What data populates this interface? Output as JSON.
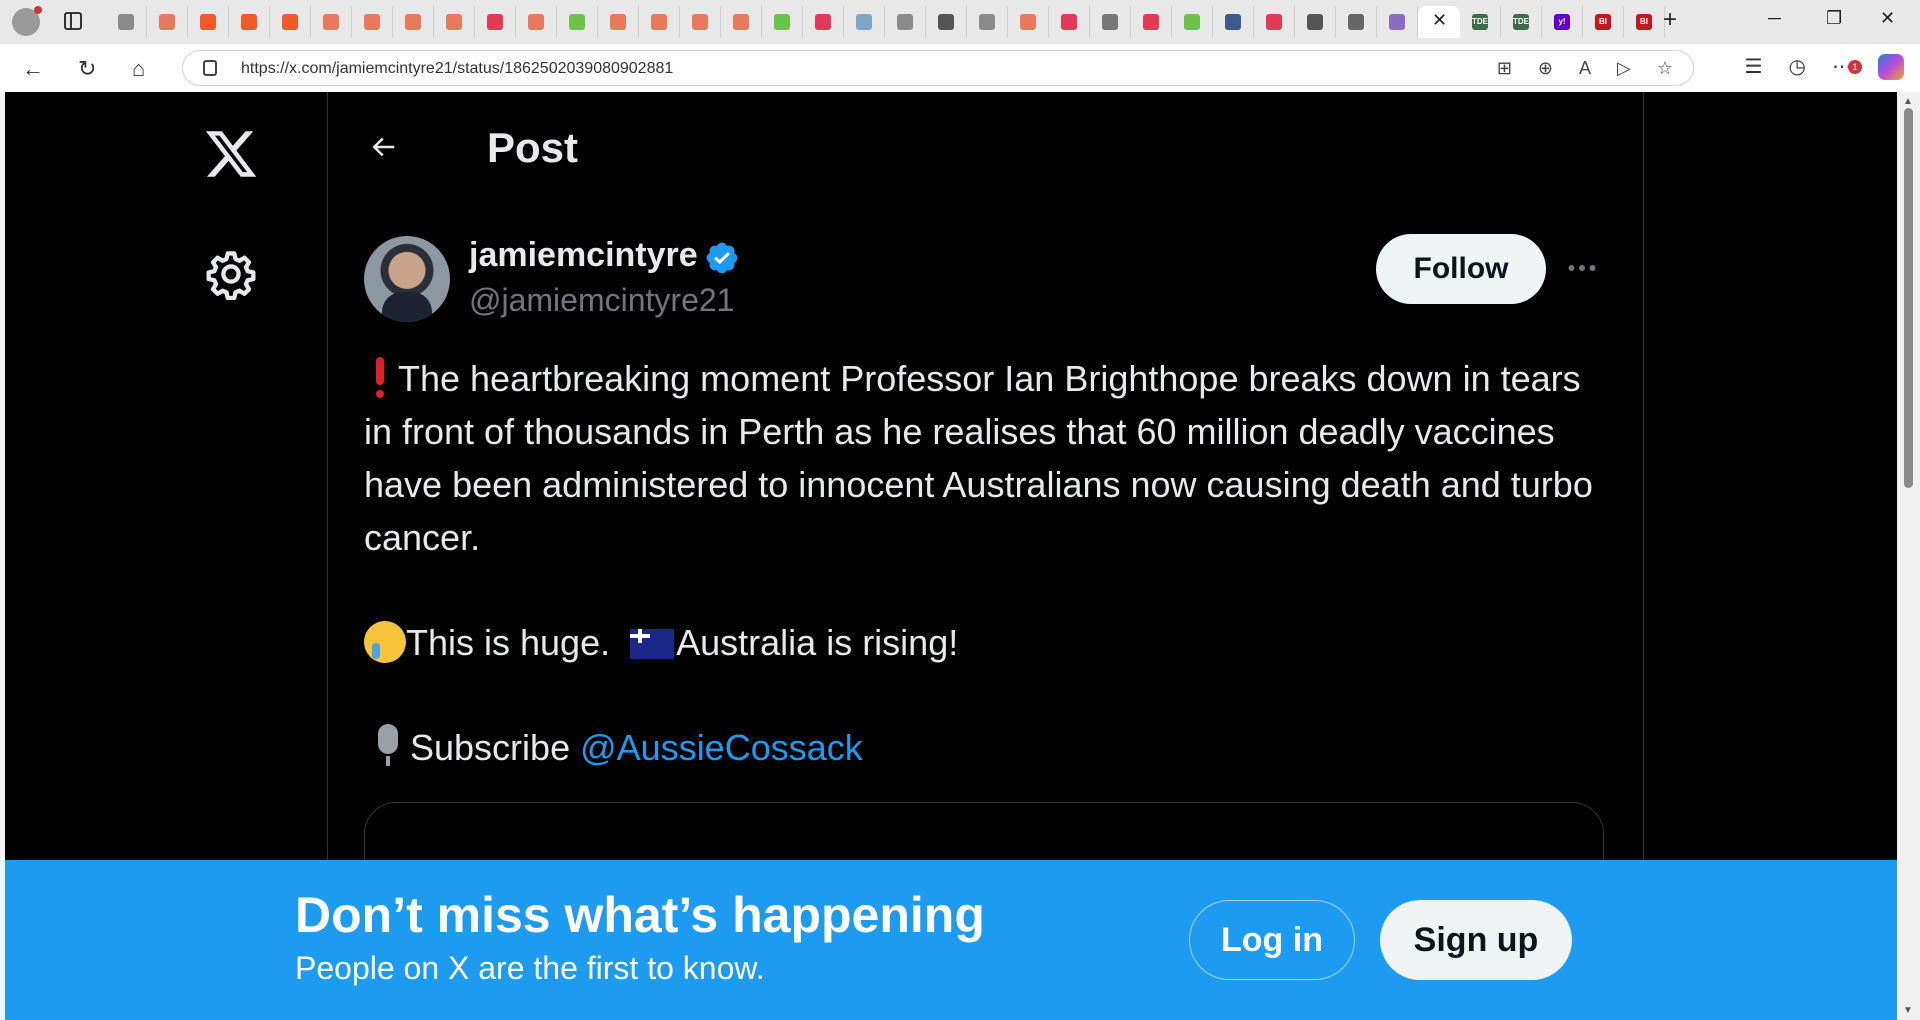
{
  "browser": {
    "url": "https://x.com/jamiemcintyre21/status/1862502039080902881",
    "tab_favicon_colors": [
      "#8a8a8a",
      "#e8795a",
      "#f05a28",
      "#f05a28",
      "#f05a28",
      "#e8795a",
      "#e8795a",
      "#e8795a",
      "#e8795a",
      "#e23a56",
      "#e8795a",
      "#6cc24a",
      "#e8795a",
      "#e8795a",
      "#e8795a",
      "#e8795a",
      "#6cc24a",
      "#e23a56",
      "#7aa7c7",
      "#8a8a8a",
      "#555555",
      "#8a8a8a",
      "#e8795a",
      "#e23a56",
      "#777777",
      "#e23a56",
      "#6cc24a",
      "#3d5a8a",
      "#e23a56",
      "#555555",
      "#666666",
      "#8a6cc2"
    ],
    "right_tab_labels": [
      "TDE",
      "TDE",
      "y!",
      "BI",
      "BI"
    ]
  },
  "page": {
    "header_title": "Post",
    "author": {
      "name": "jamiemcintyre",
      "handle": "@jamiemcintyre21",
      "verified": true
    },
    "follow_label": "Follow",
    "post": {
      "paragraph1": "The heartbreaking moment Professor Ian Brighthope breaks down in tears in front of thousands in Perth as he realises that 60 million deadly vaccines have been administered to innocent Australians now causing death and turbo cancer.",
      "paragraph2_a": "This is huge.",
      "paragraph2_b": "Australia is rising!",
      "paragraph3_text": "Subscribe",
      "paragraph3_mention": "@AussieCossack"
    }
  },
  "banner": {
    "title": "Don’t miss what’s happening",
    "subtitle": "People on X are the first to know.",
    "login_label": "Log in",
    "signup_label": "Sign up"
  },
  "colors": {
    "accent": "#1d9bf0",
    "background": "#000000",
    "text": "#e7e9ea",
    "secondary_text": "#71767b"
  }
}
